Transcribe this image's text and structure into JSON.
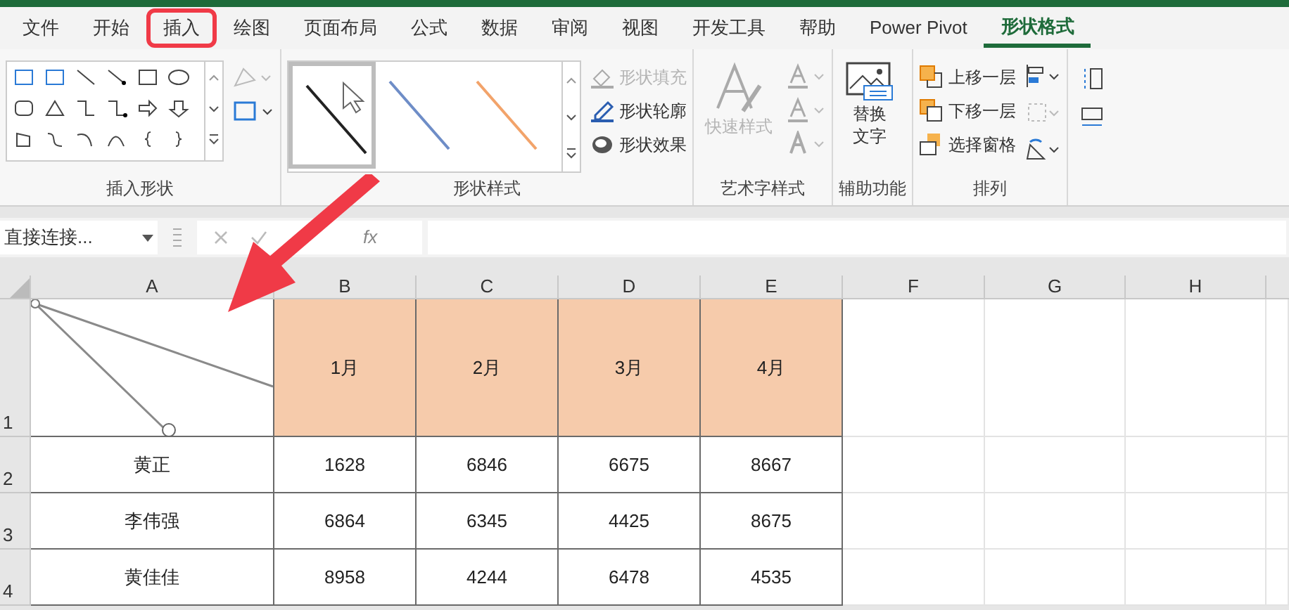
{
  "tabs": [
    {
      "label": "文件",
      "selected": false,
      "highlighted": false
    },
    {
      "label": "开始",
      "selected": false,
      "highlighted": false
    },
    {
      "label": "插入",
      "selected": false,
      "highlighted": true
    },
    {
      "label": "绘图",
      "selected": false,
      "highlighted": false
    },
    {
      "label": "页面布局",
      "selected": false,
      "highlighted": false
    },
    {
      "label": "公式",
      "selected": false,
      "highlighted": false
    },
    {
      "label": "数据",
      "selected": false,
      "highlighted": false
    },
    {
      "label": "审阅",
      "selected": false,
      "highlighted": false
    },
    {
      "label": "视图",
      "selected": false,
      "highlighted": false
    },
    {
      "label": "开发工具",
      "selected": false,
      "highlighted": false
    },
    {
      "label": "帮助",
      "selected": false,
      "highlighted": false
    },
    {
      "label": "Power Pivot",
      "selected": false,
      "highlighted": false
    },
    {
      "label": "形状格式",
      "selected": true,
      "highlighted": false
    }
  ],
  "ribbon": {
    "groups": [
      {
        "label": "插入形状"
      },
      {
        "label": "形状样式",
        "commands": [
          {
            "label": "形状填充",
            "disabled": true
          },
          {
            "label": "形状轮廓",
            "disabled": false
          },
          {
            "label": "形状效果",
            "disabled": false
          }
        ]
      },
      {
        "label": "艺术字样式",
        "commands": [
          {
            "label": "快速样式",
            "disabled": true
          }
        ]
      },
      {
        "label": "辅助功能",
        "commands": [
          {
            "label": "替换文字",
            "disabled": false
          }
        ]
      },
      {
        "label": "排列",
        "commands": [
          {
            "label": "上移一层",
            "disabled": false
          },
          {
            "label": "下移一层",
            "disabled": false
          },
          {
            "label": "选择窗格",
            "disabled": false
          }
        ]
      }
    ]
  },
  "formula_bar": {
    "name_box": "直接连接...",
    "function_label": "fx"
  },
  "sheet": {
    "columns": [
      "A",
      "B",
      "C",
      "D",
      "E",
      "F",
      "G",
      "H"
    ],
    "rows": [
      {
        "number": "1",
        "shaded": true,
        "cells": [
          "",
          "1月",
          "2月",
          "3月",
          "4月"
        ]
      },
      {
        "number": "2",
        "shaded": false,
        "cells": [
          "黄正",
          "1628",
          "6846",
          "6675",
          "8667"
        ]
      },
      {
        "number": "3",
        "shaded": false,
        "cells": [
          "李伟强",
          "6864",
          "6345",
          "4425",
          "8675"
        ]
      },
      {
        "number": "4",
        "shaded": false,
        "cells": [
          "黄佳佳",
          "8958",
          "4244",
          "6478",
          "4535"
        ]
      }
    ]
  }
}
